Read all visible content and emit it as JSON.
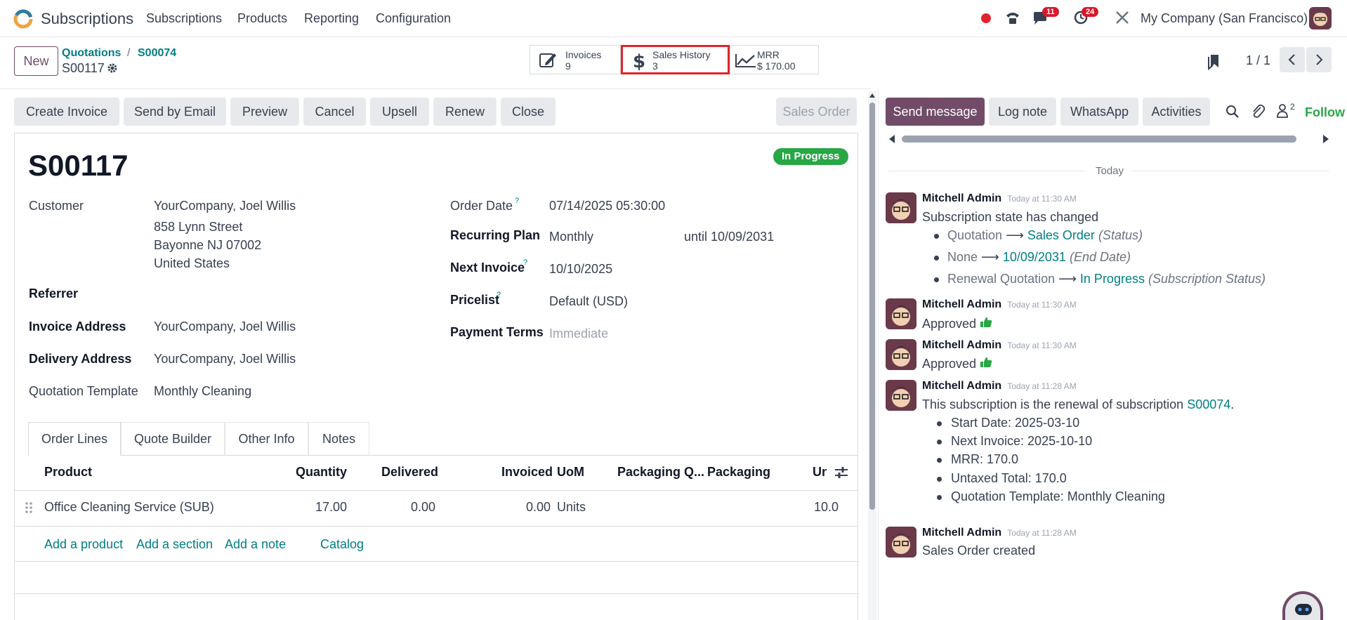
{
  "navbar": {
    "app_name": "Subscriptions",
    "menus": [
      "Subscriptions",
      "Products",
      "Reporting",
      "Configuration"
    ],
    "messages_badge": "11",
    "activities_badge": "24",
    "company": "My Company (San Francisco)"
  },
  "control": {
    "new_label": "New",
    "breadcrumb_parent": "Quotations",
    "breadcrumb_sep": "/",
    "breadcrumb_prev": "S00074",
    "record_name": "S00117",
    "pager": "1 / 1"
  },
  "smart_buttons": {
    "invoices_label": "Invoices",
    "invoices_value": "9",
    "history_label": "Sales History",
    "history_value": "3",
    "mrr_label": "MRR",
    "mrr_value": "$ 170.00"
  },
  "actions": [
    "Create Invoice",
    "Send by Email",
    "Preview",
    "Cancel",
    "Upsell",
    "Renew",
    "Close"
  ],
  "status_stage": "Sales Order",
  "form": {
    "title": "S00117",
    "status_badge": "In Progress",
    "customer_label": "Customer",
    "customer_name": "YourCompany, Joel Willis",
    "customer_street": "858 Lynn Street",
    "customer_city": "Bayonne NJ 07002",
    "customer_country": "United States",
    "referrer_label": "Referrer",
    "invoice_address_label": "Invoice Address",
    "invoice_address": "YourCompany, Joel Willis",
    "delivery_address_label": "Delivery Address",
    "delivery_address": "YourCompany, Joel Willis",
    "template_label": "Quotation Template",
    "template": "Monthly Cleaning",
    "order_date_label": "Order Date",
    "order_date": "07/14/2025 05:30:00",
    "plan_label": "Recurring Plan",
    "plan": "Monthly",
    "until": "until 10/09/2031",
    "next_invoice_label": "Next Invoice",
    "next_invoice": "10/10/2025",
    "pricelist_label": "Pricelist",
    "pricelist": "Default (USD)",
    "payment_terms_label": "Payment Terms",
    "payment_terms": "Immediate",
    "help_mark": "?"
  },
  "tabs": [
    "Order Lines",
    "Quote Builder",
    "Other Info",
    "Notes"
  ],
  "table": {
    "headers": [
      "Product",
      "Quantity",
      "Delivered",
      "Invoiced",
      "UoM",
      "Packaging Q...",
      "Packaging",
      "Uni"
    ],
    "row": [
      "Office Cleaning Service (SUB)",
      "17.00",
      "0.00",
      "0.00",
      "Units",
      "",
      "",
      "10.0"
    ],
    "add_links": [
      "Add a product",
      "Add a section",
      "Add a note",
      "Catalog"
    ]
  },
  "chatter": {
    "buttons": [
      "Send message",
      "Log note",
      "WhatsApp",
      "Activities"
    ],
    "follow": "Follow",
    "followers_count": "2",
    "today": "Today",
    "messages": [
      {
        "author": "Mitchell Admin",
        "time": "Today at 11:30 AM",
        "text": "Subscription state has changed"
      },
      {
        "author": "Mitchell Admin",
        "time": "Today at 11:30 AM",
        "text": "Approved"
      },
      {
        "author": "Mitchell Admin",
        "time": "Today at 11:30 AM",
        "text": "Approved"
      },
      {
        "author": "Mitchell Admin",
        "time": "Today at 11:28 AM",
        "text": "This subscription is the renewal of subscription",
        "link": "S00074",
        "end": "."
      },
      {
        "author": "Mitchell Admin",
        "time": "Today at 11:28 AM",
        "text": "Sales Order created"
      }
    ],
    "tracking": [
      {
        "old": "Quotation",
        "new": "Sales Order",
        "field": "(Status)"
      },
      {
        "old": "None",
        "new": "10/09/2031",
        "field": "(End Date)"
      },
      {
        "old": "Renewal Quotation",
        "new": "In Progress",
        "field": "(Subscription Status)"
      }
    ],
    "renewal_details": [
      "Start Date: 2025-03-10",
      "Next Invoice: 2025-10-10",
      "MRR: 170.0",
      "Untaxed Total: 170.0",
      "Quotation Template: Monthly Cleaning"
    ]
  },
  "colors": {
    "brand": "#714b67",
    "link": "#017e84",
    "success": "#28a745",
    "badge": "#d9182b",
    "highlight": "#e0252c"
  }
}
